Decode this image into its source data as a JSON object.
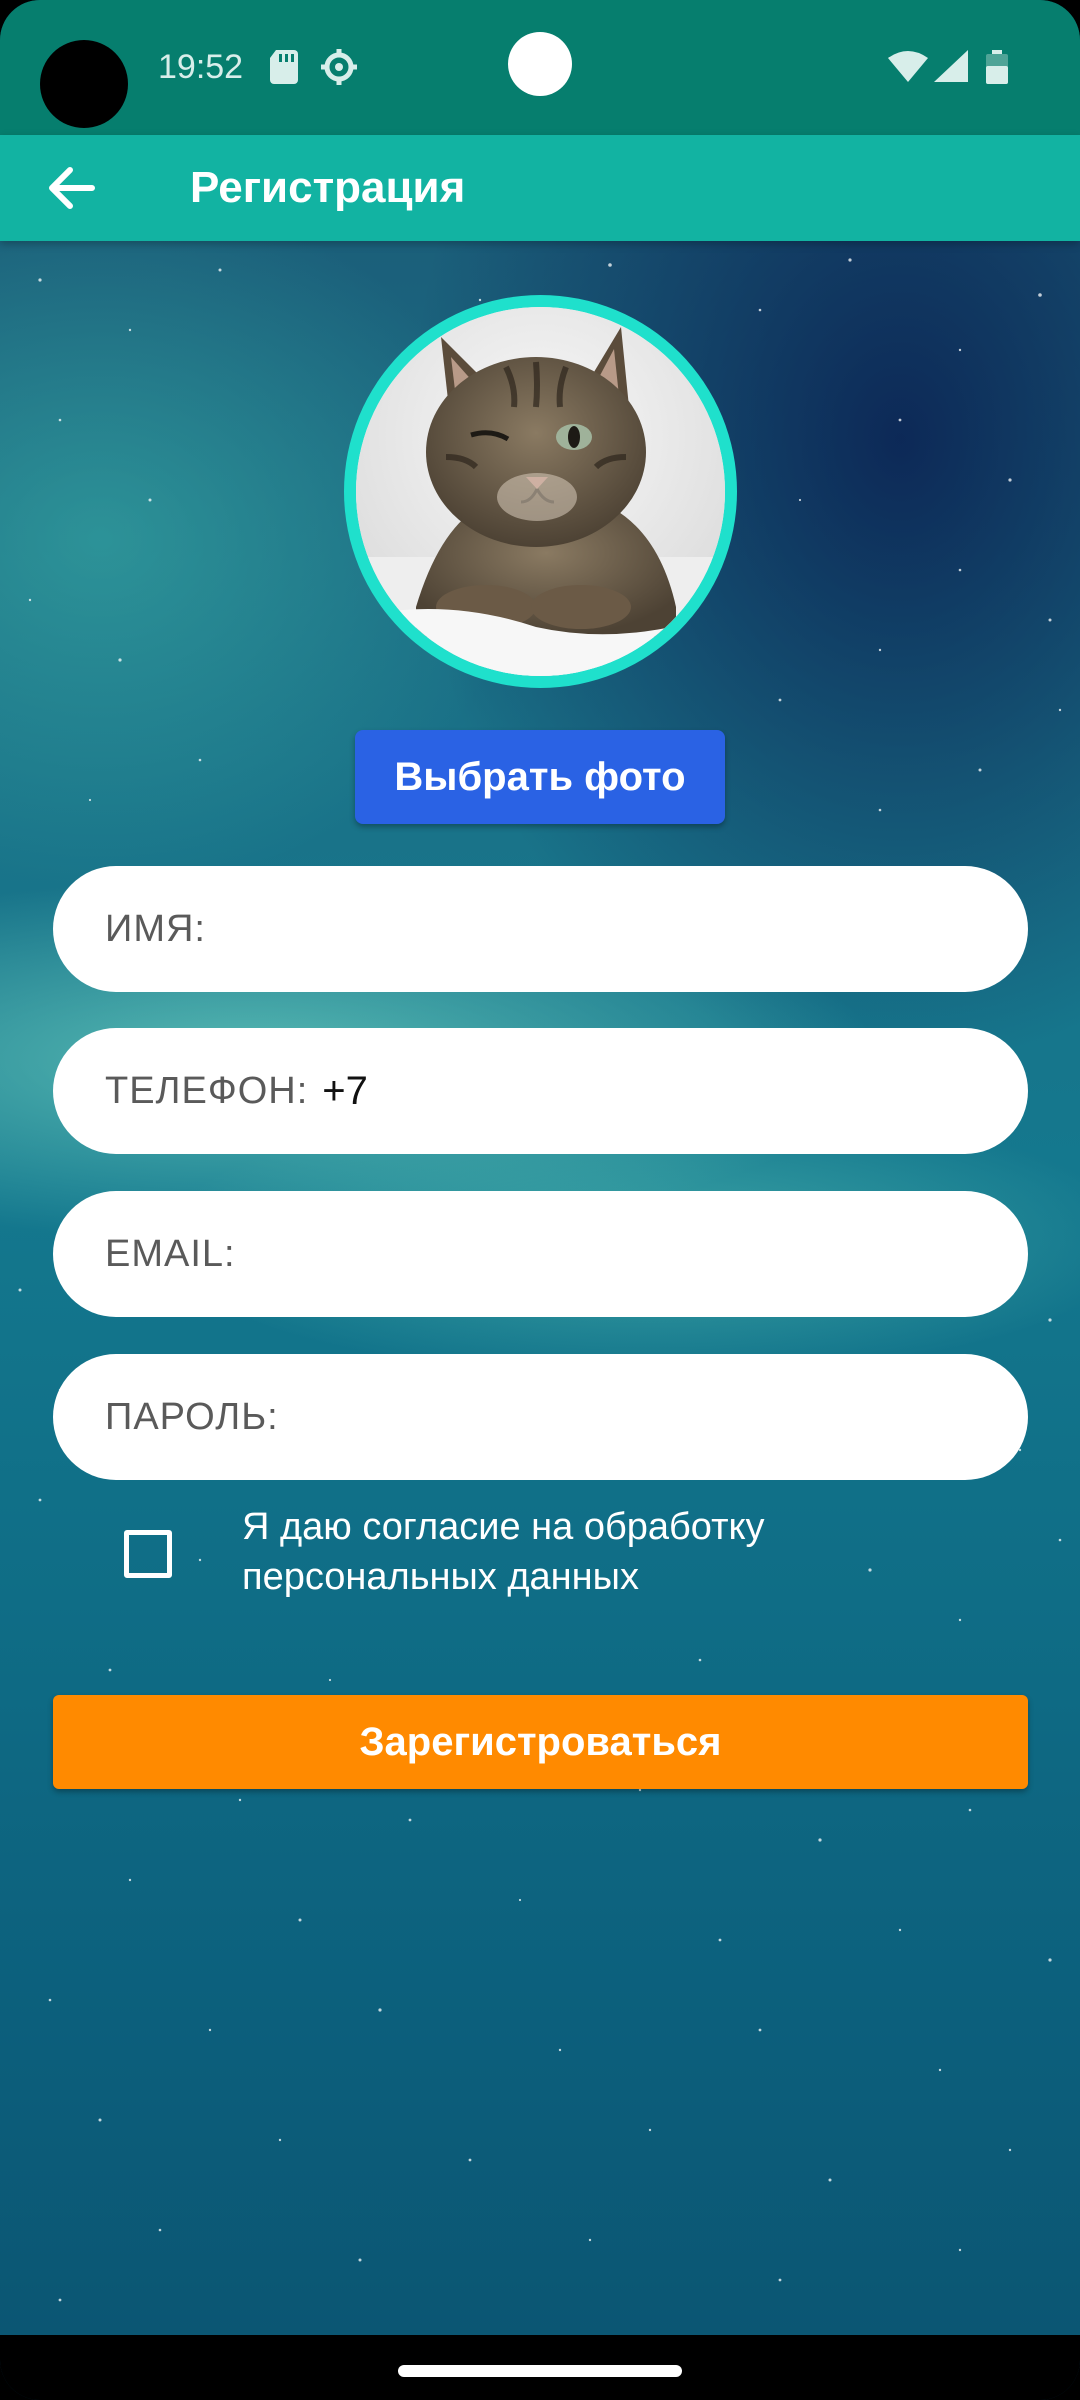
{
  "status_bar": {
    "time": "19:52",
    "icons": [
      "sd-card-icon",
      "settings-icon",
      "wifi-icon",
      "signal-icon",
      "battery-icon"
    ]
  },
  "app_bar": {
    "title": "Регистрация",
    "back_icon": "arrow-back-icon"
  },
  "avatar": {
    "description_icon": "cat-photo"
  },
  "choose_photo_label": "Выбрать фото",
  "fields": {
    "name": {
      "label": "ИМЯ:",
      "value": ""
    },
    "phone": {
      "label": "ТЕЛЕФОН:",
      "value": "+7"
    },
    "email": {
      "label": "EMAIL:",
      "value": ""
    },
    "password": {
      "label": "ПАРОЛЬ:",
      "value": ""
    }
  },
  "consent": {
    "checked": false,
    "line1": "Я даю согласие на обработку",
    "line2": "персональных данных"
  },
  "register_label": "Зарегистроваться",
  "colors": {
    "status_bar": "#067e6e",
    "app_bar": "#12b3a2",
    "avatar_ring": "#1fe0cc",
    "choose_photo_button": "#2a62e4",
    "register_button": "#ff8a00"
  }
}
